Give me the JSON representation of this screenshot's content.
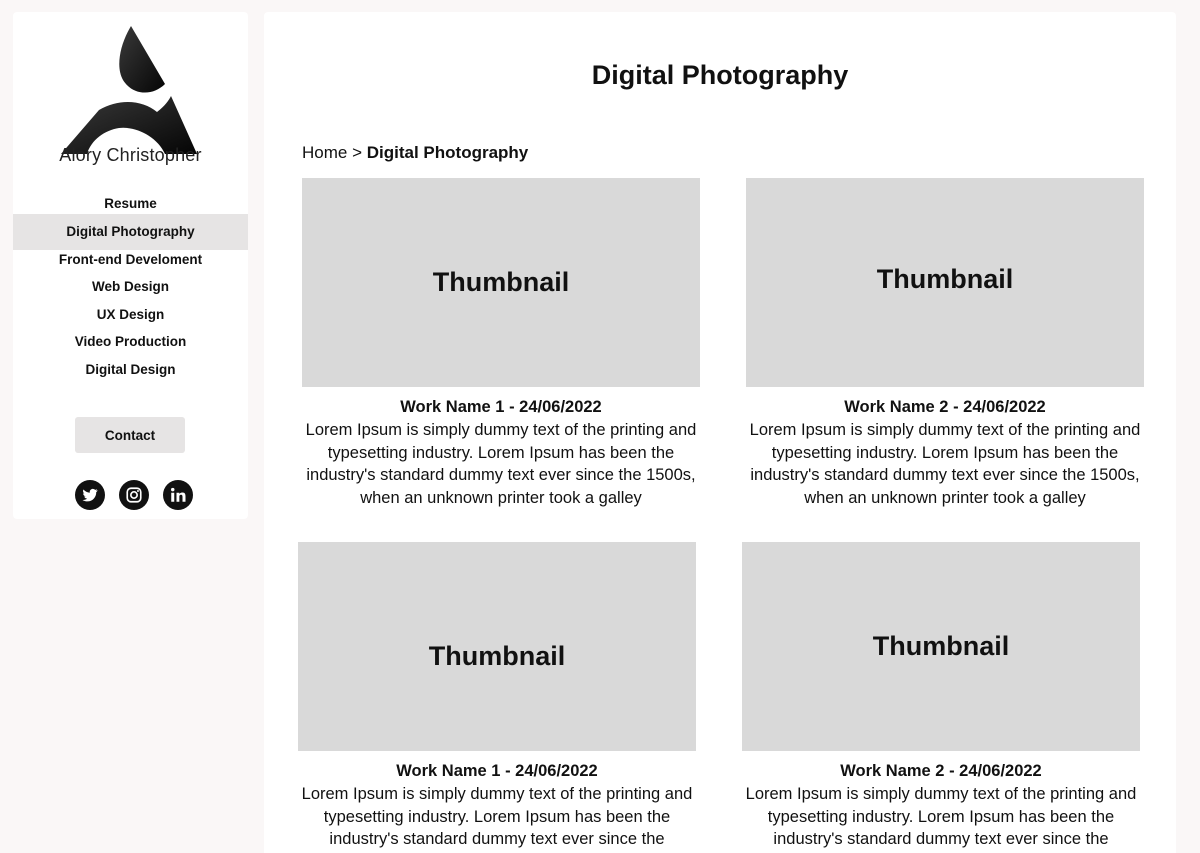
{
  "sidebar": {
    "brand_name": "Alory Christopher",
    "nav_items": [
      {
        "label": "Resume",
        "active": false
      },
      {
        "label": "Digital Photography",
        "active": true
      },
      {
        "label": "Front-end Develoment",
        "active": false
      },
      {
        "label": "Web Design",
        "active": false
      },
      {
        "label": "UX Design",
        "active": false
      },
      {
        "label": "Video Production",
        "active": false
      },
      {
        "label": "Digital Design",
        "active": false
      }
    ],
    "contact_label": "Contact",
    "social_icons": [
      "twitter-icon",
      "instagram-icon",
      "linkedin-icon"
    ]
  },
  "main": {
    "title": "Digital Photography",
    "breadcrumb": {
      "home": "Home",
      "separator": ">",
      "current": "Digital Photography"
    },
    "cards": [
      {
        "thumbnail": "Thumbnail",
        "title": "Work Name 1 - 24/06/2022",
        "description": "Lorem Ipsum is simply dummy text of the printing and typesetting industry. Lorem Ipsum has been the industry's standard dummy text ever since the 1500s, when an unknown printer took a galley"
      },
      {
        "thumbnail": "Thumbnail",
        "title": "Work Name 2 - 24/06/2022",
        "description": "Lorem Ipsum is simply dummy text of the printing and typesetting industry. Lorem Ipsum has been the industry's standard dummy text ever since the 1500s, when an unknown printer took a galley"
      },
      {
        "thumbnail": "Thumbnail",
        "title": "Work Name 1 - 24/06/2022",
        "description": "Lorem Ipsum is simply dummy text of the printing and typesetting industry. Lorem Ipsum has been the industry's standard dummy text ever since the"
      },
      {
        "thumbnail": "Thumbnail",
        "title": "Work Name 2 - 24/06/2022",
        "description": "Lorem Ipsum is simply dummy text of the printing and typesetting industry. Lorem Ipsum has been the industry's standard dummy text ever since the"
      }
    ]
  },
  "colors": {
    "page_background": "#faf7f7",
    "panel_background": "#ffffff",
    "thumbnail_background": "#d9d9d9",
    "active_nav_background": "#e6e4e4",
    "text": "#111111"
  }
}
